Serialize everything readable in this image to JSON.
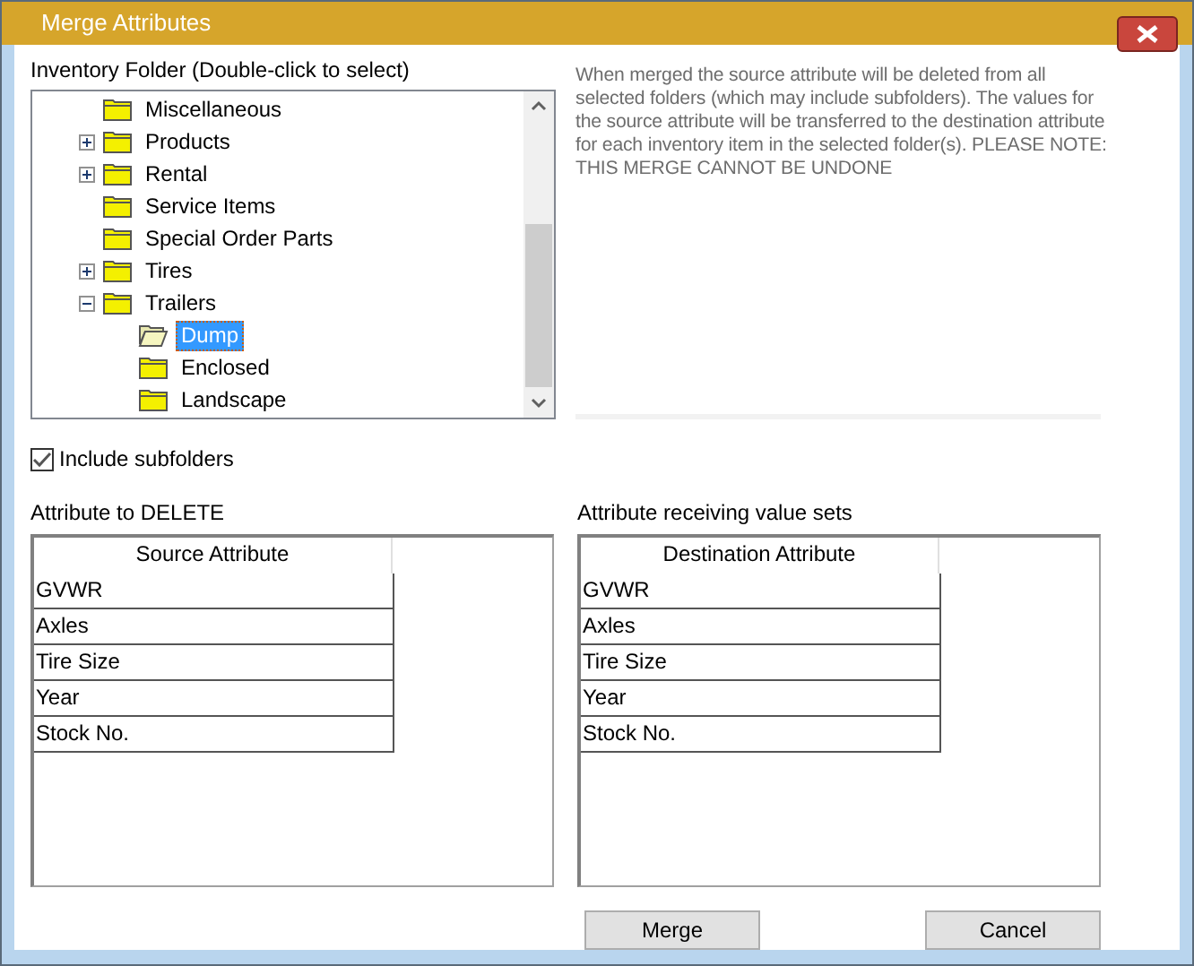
{
  "window": {
    "title": "Merge Attributes"
  },
  "folder_tree": {
    "label": "Inventory Folder (Double-click to select)",
    "items": [
      {
        "label": "Miscellaneous",
        "selected": false
      },
      {
        "label": "Products",
        "selected": false,
        "expanded": false
      },
      {
        "label": "Rental",
        "selected": false,
        "expanded": false
      },
      {
        "label": "Service Items",
        "selected": false
      },
      {
        "label": "Special Order Parts",
        "selected": false
      },
      {
        "label": "Tires",
        "selected": false,
        "expanded": false
      },
      {
        "label": "Trailers",
        "selected": false,
        "expanded": true,
        "children": [
          {
            "label": "Dump",
            "selected": true
          },
          {
            "label": "Enclosed",
            "selected": false
          },
          {
            "label": "Landscape",
            "selected": false
          }
        ]
      }
    ]
  },
  "note": "When merged the source attribute will be deleted from all selected folders (which may include subfolders). The values for the source attribute will be transferred to the destination attribute for each inventory item in the selected folder(s). PLEASE NOTE: THIS MERGE CANNOT BE UNDONE",
  "include_subfolders": {
    "label": "Include subfolders",
    "checked": true
  },
  "grids": [
    {
      "label": "Attribute to DELETE",
      "column": "Source Attribute",
      "rows": [
        "GVWR",
        "Axles",
        "Tire Size",
        "Year",
        "Stock No."
      ]
    },
    {
      "label": "Attribute receiving value sets",
      "column": "Destination Attribute",
      "rows": [
        "GVWR",
        "Axles",
        "Tire Size",
        "Year",
        "Stock No."
      ]
    }
  ],
  "buttons": [
    "Merge",
    "Cancel"
  ]
}
